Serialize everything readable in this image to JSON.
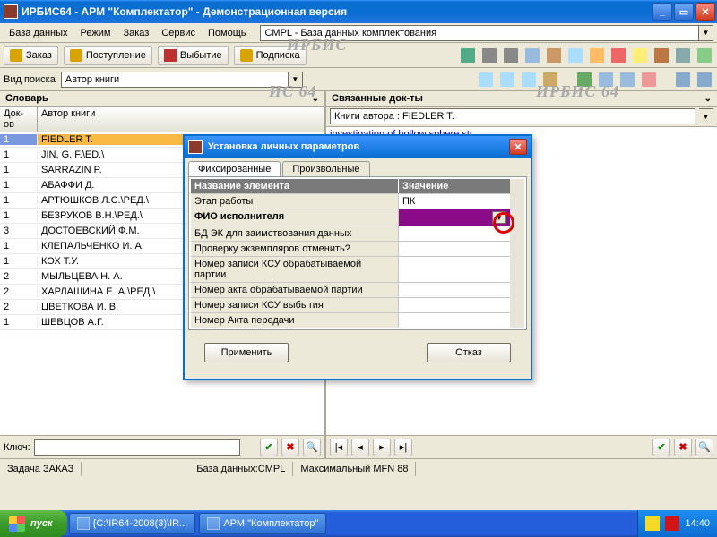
{
  "window": {
    "title": "ИРБИС64 - АРМ \"Комплектатор\" - Демонстрационная версия"
  },
  "menu": {
    "items": [
      "База данных",
      "Режим",
      "Заказ",
      "Сервис",
      "Помощь"
    ],
    "db_field": "CMPL - База данных комплектования"
  },
  "toolbar1": {
    "buttons": [
      {
        "label": "Заказ",
        "icon_color": "#d9a400"
      },
      {
        "label": "Поступление",
        "icon_color": "#d9a400"
      },
      {
        "label": "Выбытие",
        "icon_color": "#c03030"
      },
      {
        "label": "Подписка",
        "icon_color": "#d9a400"
      }
    ]
  },
  "search": {
    "label": "Вид поиска",
    "value": "Автор книги"
  },
  "left": {
    "title": "Словарь",
    "col_qty": "Док-ов",
    "col_name": "Автор книги",
    "rows": [
      {
        "qty": "1",
        "name": "FIEDLER T."
      },
      {
        "qty": "1",
        "name": "JIN, G. F.\\ED.\\"
      },
      {
        "qty": "1",
        "name": "SARRAZIN P."
      },
      {
        "qty": "1",
        "name": "АБАФФИ Д."
      },
      {
        "qty": "1",
        "name": "АРТЮШКОВ Л.С.\\РЕД.\\"
      },
      {
        "qty": "1",
        "name": "БЕЗРУКОВ В.Н.\\РЕД.\\"
      },
      {
        "qty": "3",
        "name": "ДОСТОЕВСКИЙ Ф.М."
      },
      {
        "qty": "1",
        "name": "КЛЕПАЛЬЧЕНКО И. А."
      },
      {
        "qty": "1",
        "name": "КОХ Т.У."
      },
      {
        "qty": "2",
        "name": "МЫЛЬЦЕВА Н. А."
      },
      {
        "qty": "2",
        "name": "ХАРЛАШИНА Е. А.\\РЕД.\\"
      },
      {
        "qty": "2",
        "name": "ЦВЕТКОВА И. В."
      },
      {
        "qty": "1",
        "name": "ШЕВЦОВ А.Г."
      }
    ]
  },
  "right": {
    "title": "Связанные док-ты",
    "filter_value": "Книги автора : FIEDLER T.",
    "entry": "investigation of hollow sphere str"
  },
  "bottom": {
    "key_label": "Ключ:"
  },
  "status": {
    "task": "Задача ЗАКАЗ",
    "db": "База данных:CMPL",
    "mfn": "Максимальный MFN 88"
  },
  "dialog": {
    "title": "Установка личных параметров",
    "tabs": [
      "Фиксированные",
      "Произвольные"
    ],
    "active_tab": 0,
    "header_name": "Название элемента",
    "header_val": "Значение",
    "rows": [
      {
        "name": "Этап работы",
        "value": "ПК"
      },
      {
        "name": "ФИО исполнителя",
        "value": ""
      },
      {
        "name": "БД ЭК для заимствования данных",
        "value": ""
      },
      {
        "name": "Проверку экземпляров отменить?",
        "value": ""
      },
      {
        "name": "Номер записи КСУ обрабатываемой партии",
        "value": ""
      },
      {
        "name": "Номер акта обрабатываемой партии",
        "value": ""
      },
      {
        "name": "Номер записи КСУ выбытия",
        "value": ""
      },
      {
        "name": "Номер Акта передачи",
        "value": ""
      }
    ],
    "selected_row": 1,
    "apply": "Применить",
    "cancel": "Отказ"
  },
  "taskbar": {
    "start": "пуск",
    "tasks": [
      "{C:\\IR64-2008(3)\\IR...",
      "АРМ \"Комплектатор\""
    ],
    "clock": "14:40"
  },
  "watermark": "ИРБИС 64"
}
